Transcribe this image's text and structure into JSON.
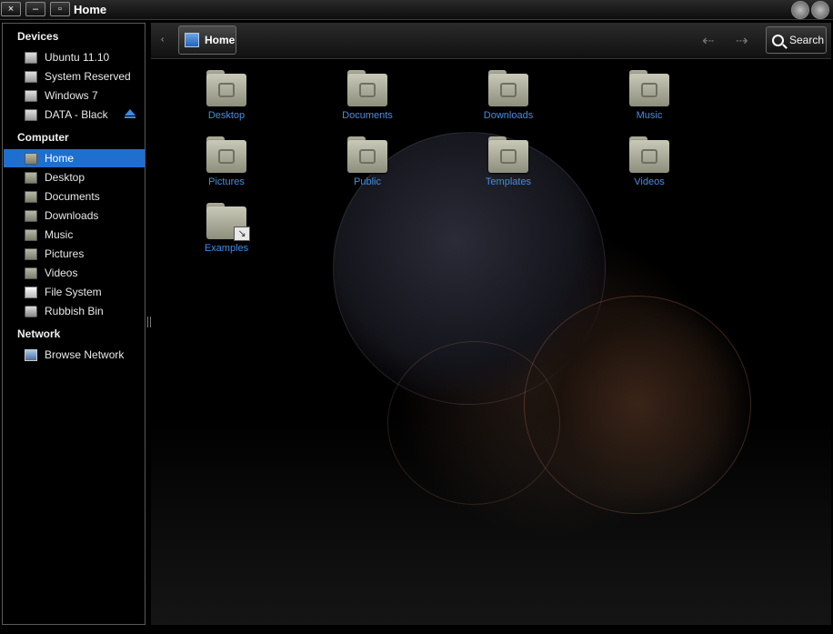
{
  "window": {
    "title": "Home",
    "close_label": "×",
    "minimize_label": "–",
    "maximize_label": "▫"
  },
  "sidebar": {
    "devices_header": "Devices",
    "devices": [
      {
        "label": "Ubuntu 11.10",
        "icon": "drive-icon"
      },
      {
        "label": "System Reserved",
        "icon": "drive-icon"
      },
      {
        "label": "Windows 7",
        "icon": "drive-icon"
      },
      {
        "label": "DATA - Black",
        "icon": "drive-icon",
        "eject": true
      }
    ],
    "computer_header": "Computer",
    "computer": [
      {
        "label": "Home",
        "icon": "home-folder-icon",
        "active": true
      },
      {
        "label": "Desktop",
        "icon": "folder-icon"
      },
      {
        "label": "Documents",
        "icon": "folder-icon"
      },
      {
        "label": "Downloads",
        "icon": "folder-icon"
      },
      {
        "label": "Music",
        "icon": "folder-icon"
      },
      {
        "label": "Pictures",
        "icon": "folder-icon"
      },
      {
        "label": "Videos",
        "icon": "folder-icon"
      },
      {
        "label": "File System",
        "icon": "filesystem-icon"
      },
      {
        "label": "Rubbish Bin",
        "icon": "trash-icon"
      }
    ],
    "network_header": "Network",
    "network": [
      {
        "label": "Browse Network",
        "icon": "network-icon"
      }
    ]
  },
  "toolbar": {
    "breadcrumb_back": "‹",
    "breadcrumb_home": "Home",
    "back_arrow": "⇠",
    "forward_arrow": "⇢",
    "search_label": "Search"
  },
  "files": [
    {
      "label": "Desktop",
      "icon": "desktop-folder-icon"
    },
    {
      "label": "Documents",
      "icon": "documents-folder-icon"
    },
    {
      "label": "Downloads",
      "icon": "downloads-folder-icon"
    },
    {
      "label": "Music",
      "icon": "music-folder-icon"
    },
    {
      "label": "Pictures",
      "icon": "pictures-folder-icon"
    },
    {
      "label": "Public",
      "icon": "public-folder-icon"
    },
    {
      "label": "Templates",
      "icon": "templates-folder-icon"
    },
    {
      "label": "Videos",
      "icon": "videos-folder-icon"
    },
    {
      "label": "Examples",
      "icon": "examples-folder-link-icon"
    }
  ],
  "colors": {
    "accent": "#1f6fcf",
    "file_label": "#3f8fe8",
    "eject": "#3a8be6"
  }
}
